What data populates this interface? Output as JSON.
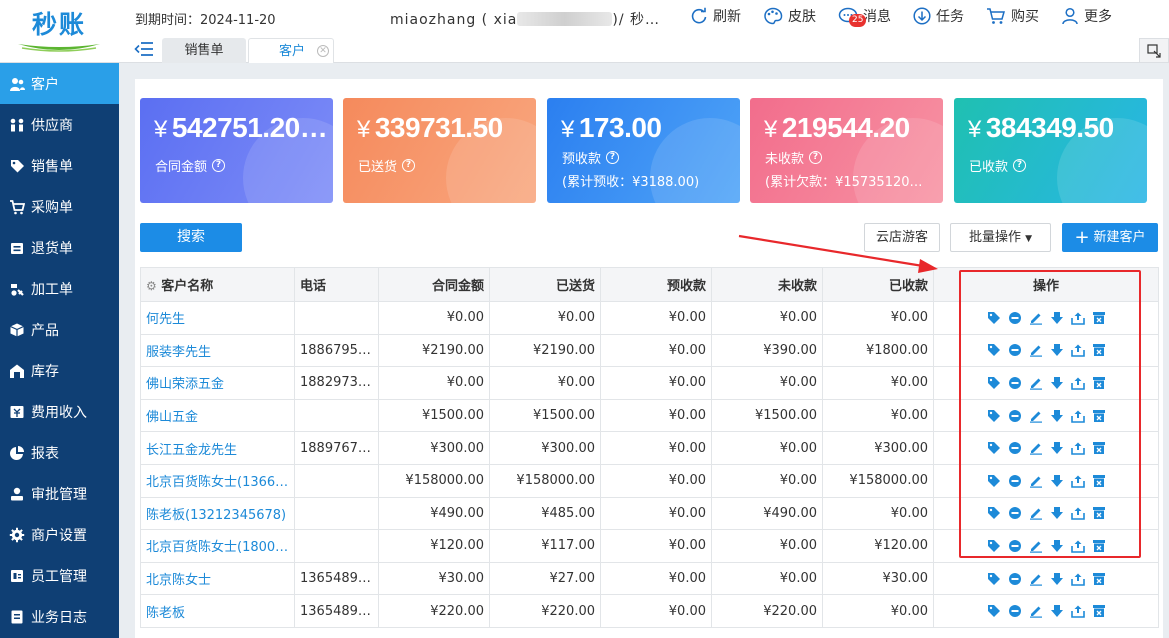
{
  "app": {
    "logo": "秒账"
  },
  "header": {
    "expire": "到期时间：2024-11-20",
    "account_prefix": "miaozhang ( xia",
    "account_suffix": ")/ 秒…",
    "tools": [
      {
        "label": "刷新",
        "icon": "refresh-icon"
      },
      {
        "label": "皮肤",
        "icon": "palette-icon"
      },
      {
        "label": "消息",
        "icon": "chat-icon",
        "badge": "25"
      },
      {
        "label": "任务",
        "icon": "download-circle-icon"
      },
      {
        "label": "购买",
        "icon": "cart-icon"
      },
      {
        "label": "更多",
        "icon": "user-icon"
      }
    ]
  },
  "tabs": [
    {
      "label": "销售单"
    },
    {
      "label": "客户",
      "active": true
    }
  ],
  "sidebar": {
    "items": [
      {
        "label": "客户",
        "icon": "users-icon",
        "active": true
      },
      {
        "label": "供应商",
        "icon": "supplier-icon"
      },
      {
        "label": "销售单",
        "icon": "tag-icon"
      },
      {
        "label": "采购单",
        "icon": "cart-icon"
      },
      {
        "label": "退货单",
        "icon": "return-icon"
      },
      {
        "label": "加工单",
        "icon": "process-icon"
      },
      {
        "label": "产品",
        "icon": "box-icon"
      },
      {
        "label": "库存",
        "icon": "warehouse-icon"
      },
      {
        "label": "费用收入",
        "icon": "money-icon"
      },
      {
        "label": "报表",
        "icon": "pie-chart-icon"
      },
      {
        "label": "审批管理",
        "icon": "approval-icon"
      },
      {
        "label": "商户设置",
        "icon": "gear-icon"
      },
      {
        "label": "员工管理",
        "icon": "staff-icon"
      },
      {
        "label": "业务日志",
        "icon": "log-icon"
      }
    ]
  },
  "cards": [
    {
      "amount": "542751.20…",
      "label": "合同金额",
      "sub": "",
      "color_from": "#5b6ff2",
      "color_to": "#7d8cf7"
    },
    {
      "amount": "339731.50",
      "label": "已送货",
      "sub": "",
      "color_from": "#f58a5c",
      "color_to": "#f9a77f"
    },
    {
      "amount": "173.00",
      "label": "预收款",
      "sub": "(累计预收：¥3188.00)",
      "color_from": "#2b7ff0",
      "color_to": "#4fa4f7"
    },
    {
      "amount": "219544.20",
      "label": "未收款",
      "sub": "(累计欠款：¥15735120…",
      "color_from": "#f26d8c",
      "color_to": "#f793a3"
    },
    {
      "amount": "384349.50",
      "label": "已收款",
      "sub": "",
      "color_from": "#1fc0b1",
      "color_to": "#29b6e6"
    }
  ],
  "currency_symbol": "¥",
  "toolbar": {
    "search": "搜索",
    "guest": "云店游客",
    "batch": "批量操作",
    "new_customer": "新建客户"
  },
  "table": {
    "headers": [
      "客户名称",
      "电话",
      "合同金额",
      "已送货",
      "预收款",
      "未收款",
      "已收款",
      "操作"
    ],
    "rows": [
      [
        "何先生",
        "",
        "¥0.00",
        "¥0.00",
        "¥0.00",
        "¥0.00",
        "¥0.00"
      ],
      [
        "服装李先生",
        "1886795…",
        "¥2190.00",
        "¥2190.00",
        "¥0.00",
        "¥390.00",
        "¥1800.00"
      ],
      [
        "佛山荣添五金",
        "1882973…",
        "¥0.00",
        "¥0.00",
        "¥0.00",
        "¥0.00",
        "¥0.00"
      ],
      [
        "佛山五金",
        "",
        "¥1500.00",
        "¥1500.00",
        "¥0.00",
        "¥1500.00",
        "¥0.00"
      ],
      [
        "长江五金龙先生",
        "1889767…",
        "¥300.00",
        "¥300.00",
        "¥0.00",
        "¥0.00",
        "¥300.00"
      ],
      [
        "北京百货陈女士(1366…",
        "",
        "¥158000.00",
        "¥158000.00",
        "¥0.00",
        "¥0.00",
        "¥158000.00"
      ],
      [
        "陈老板(13212345678)",
        "",
        "¥490.00",
        "¥485.00",
        "¥0.00",
        "¥490.00",
        "¥0.00"
      ],
      [
        "北京百货陈女士(1800…",
        "",
        "¥120.00",
        "¥117.00",
        "¥0.00",
        "¥0.00",
        "¥120.00"
      ],
      [
        "北京陈女士",
        "1365489…",
        "¥30.00",
        "¥27.00",
        "¥0.00",
        "¥0.00",
        "¥30.00"
      ],
      [
        "陈老板",
        "1365489…",
        "¥220.00",
        "¥220.00",
        "¥0.00",
        "¥220.00",
        "¥0.00"
      ]
    ],
    "op_icons": [
      "tag-icon",
      "disable-icon",
      "edit-icon",
      "download-icon",
      "share-icon",
      "archive-icon"
    ]
  },
  "colors": {
    "accent": "#1c8ce6",
    "sidebar": "#0f3f74",
    "annotation": "#e8282b"
  }
}
